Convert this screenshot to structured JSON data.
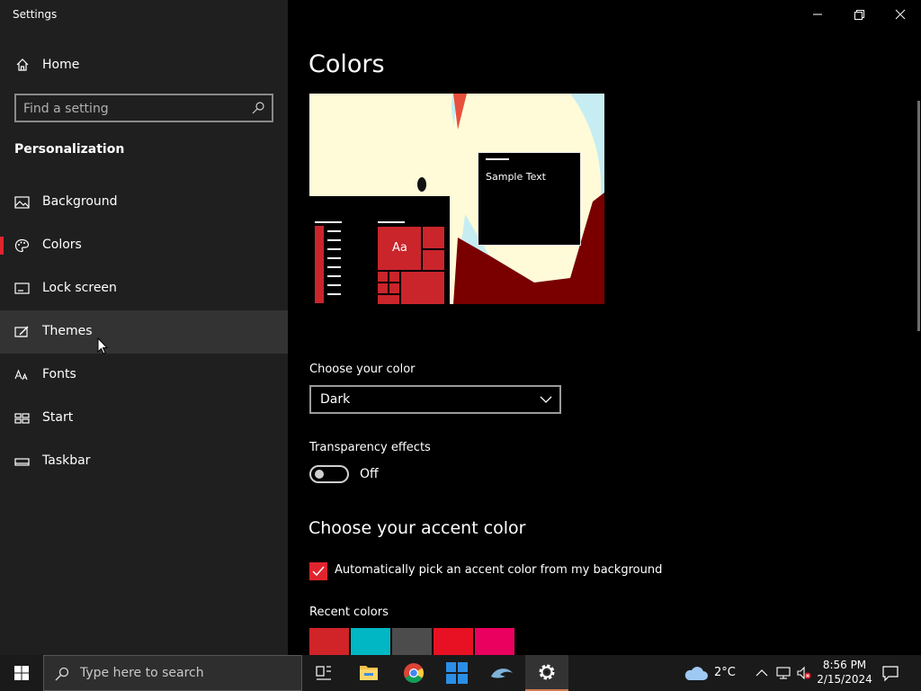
{
  "window": {
    "title": "Settings"
  },
  "sidebar": {
    "home_label": "Home",
    "search_placeholder": "Find a setting",
    "section_heading": "Personalization",
    "items": [
      {
        "label": "Background",
        "icon": "image-icon"
      },
      {
        "label": "Colors",
        "icon": "palette-icon",
        "selected": true
      },
      {
        "label": "Lock screen",
        "icon": "lock-screen-icon"
      },
      {
        "label": "Themes",
        "icon": "themes-icon",
        "hover": true
      },
      {
        "label": "Fonts",
        "icon": "fonts-icon"
      },
      {
        "label": "Start",
        "icon": "start-icon"
      },
      {
        "label": "Taskbar",
        "icon": "taskbar-icon"
      }
    ]
  },
  "main": {
    "title": "Colors",
    "preview": {
      "sample_text": "Sample Text",
      "tile_label": "Aa"
    },
    "choose_color": {
      "label": "Choose your color",
      "value": "Dark"
    },
    "transparency": {
      "label": "Transparency effects",
      "state": "Off",
      "on": false
    },
    "accent": {
      "title": "Choose your accent color",
      "auto_label": "Automatically pick an accent color from my background",
      "auto_checked": true
    },
    "recent_colors": {
      "label": "Recent colors",
      "swatches": [
        "#d02428",
        "#00b7c3",
        "#4c4c4c",
        "#e81123",
        "#ea005e"
      ]
    }
  },
  "taskbar": {
    "search_placeholder": "Type here to search",
    "weather_temp": "2°C",
    "time": "8:56 PM",
    "date": "2/15/2024"
  },
  "colors": {
    "accent": "#e0242e",
    "sidebar_bg": "#1f1f1f",
    "main_bg": "#000000",
    "taskbar_bg": "#1a1a1a"
  }
}
